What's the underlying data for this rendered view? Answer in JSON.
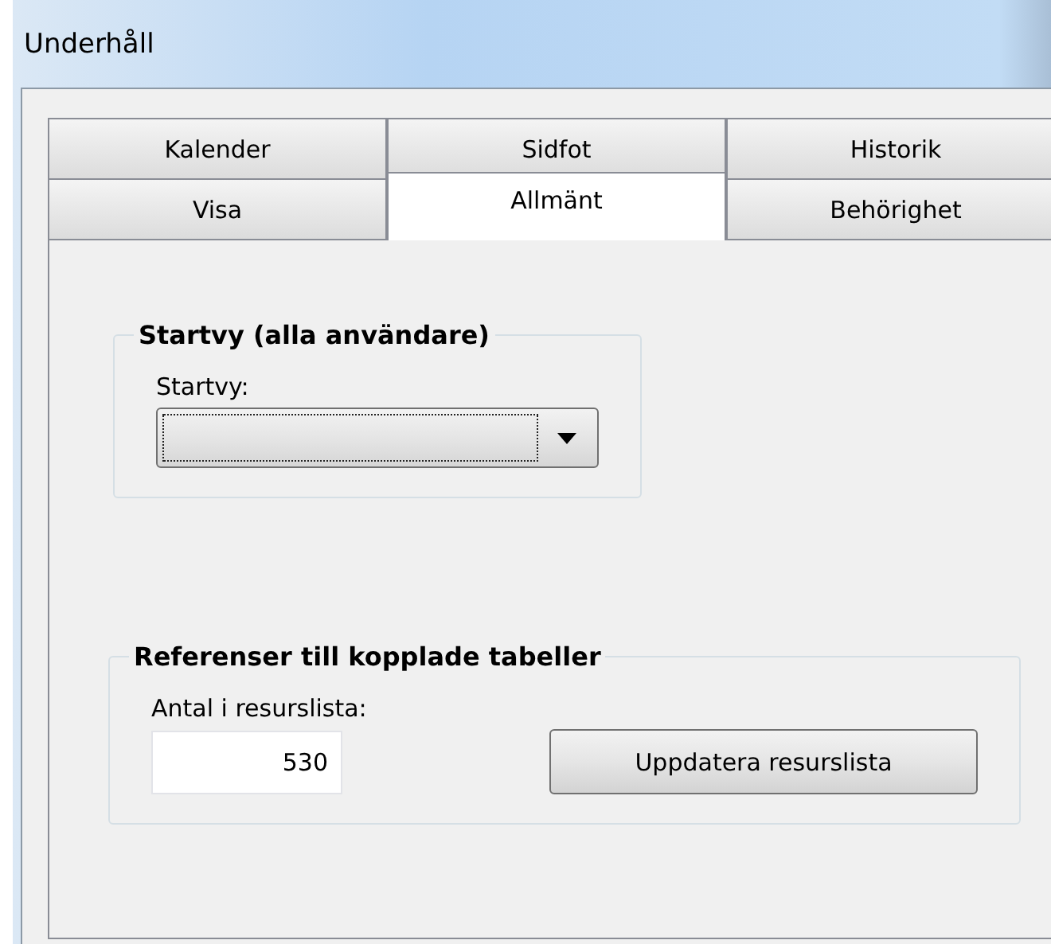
{
  "window": {
    "title": "Underhåll"
  },
  "tab_rows": [
    [
      {
        "label": "Kalender",
        "selected": false
      },
      {
        "label": "Sidfot",
        "selected": false
      },
      {
        "label": "Historik",
        "selected": false
      }
    ],
    [
      {
        "label": "Visa",
        "selected": false
      },
      {
        "label": "Allmänt",
        "selected": true
      },
      {
        "label": "Behörighet",
        "selected": false
      }
    ]
  ],
  "groups": [
    {
      "title": "Startvy (alla användare)",
      "kind": "combo",
      "label": "Startvy:",
      "focused": true
    },
    {
      "title": "Referenser till kopplade tabeller",
      "kind": "count",
      "label": "Antal i resurslista:",
      "value": "530",
      "button": "Uppdatera resurslista"
    }
  ]
}
